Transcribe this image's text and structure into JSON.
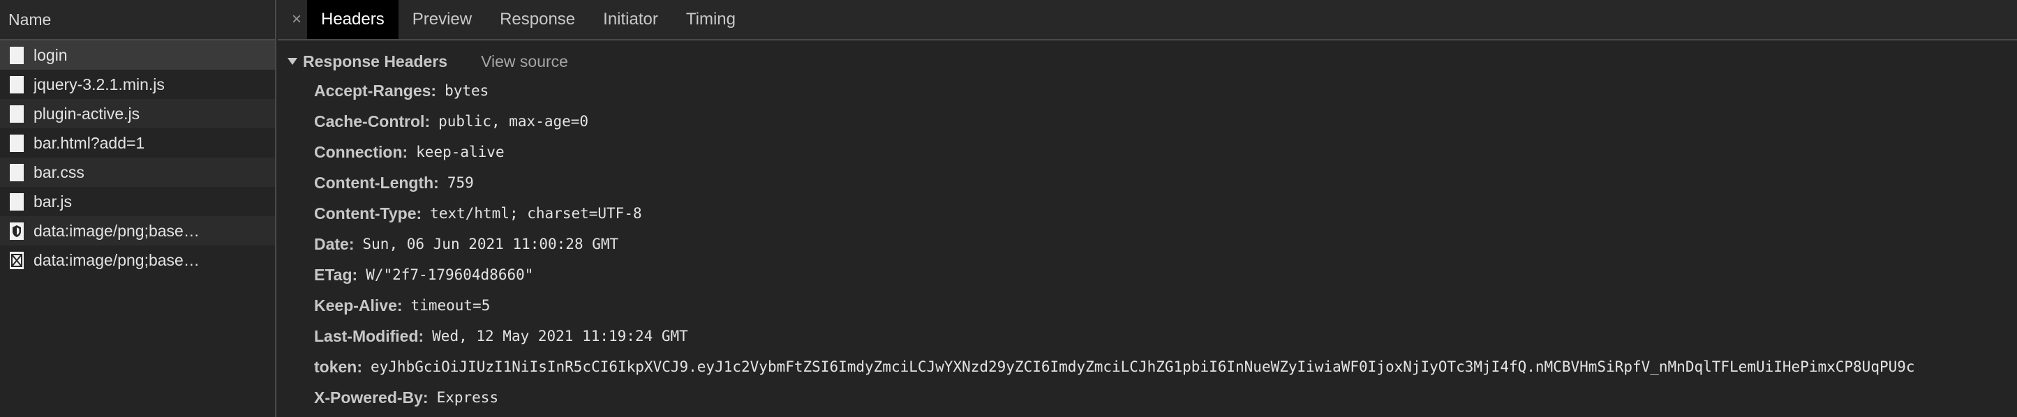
{
  "sidebar": {
    "header": "Name",
    "requests": [
      {
        "name": "login",
        "icon": "file-icon"
      },
      {
        "name": "jquery-3.2.1.min.js",
        "icon": "file-icon"
      },
      {
        "name": "plugin-active.js",
        "icon": "file-icon"
      },
      {
        "name": "bar.html?add=1",
        "icon": "file-icon"
      },
      {
        "name": "bar.css",
        "icon": "file-icon"
      },
      {
        "name": "bar.js",
        "icon": "file-icon"
      },
      {
        "name": "data:image/png;base…",
        "icon": "shield-icon"
      },
      {
        "name": "data:image/png;base…",
        "icon": "broken-image-icon"
      }
    ]
  },
  "tabs": {
    "close": "×",
    "items": [
      "Headers",
      "Preview",
      "Response",
      "Initiator",
      "Timing"
    ],
    "active": "Headers"
  },
  "section": {
    "title": "Response Headers",
    "view_source": "View source"
  },
  "headers": [
    {
      "name": "Accept-Ranges:",
      "value": "bytes"
    },
    {
      "name": "Cache-Control:",
      "value": "public, max-age=0"
    },
    {
      "name": "Connection:",
      "value": "keep-alive"
    },
    {
      "name": "Content-Length:",
      "value": "759"
    },
    {
      "name": "Content-Type:",
      "value": "text/html; charset=UTF-8"
    },
    {
      "name": "Date:",
      "value": "Sun, 06 Jun 2021 11:00:28 GMT"
    },
    {
      "name": "ETag:",
      "value": "W/\"2f7-179604d8660\""
    },
    {
      "name": "Keep-Alive:",
      "value": "timeout=5"
    },
    {
      "name": "Last-Modified:",
      "value": "Wed, 12 May 2021 11:19:24 GMT"
    },
    {
      "name": "token:",
      "value": "eyJhbGciOiJIUzI1NiIsInR5cCI6IkpXVCJ9.eyJ1c2VybmFtZSI6ImdyZmciLCJwYXNzd29yZCI6ImdyZmciLCJhZG1pbiI6InNueWZyIiwiaWF0IjoxNjIyOTc3MjI4fQ.nMCBVHmSiRpfV_nMnDqlTFLemUiIHePimxCP8UqPU9c"
    },
    {
      "name": "X-Powered-By:",
      "value": "Express"
    }
  ]
}
